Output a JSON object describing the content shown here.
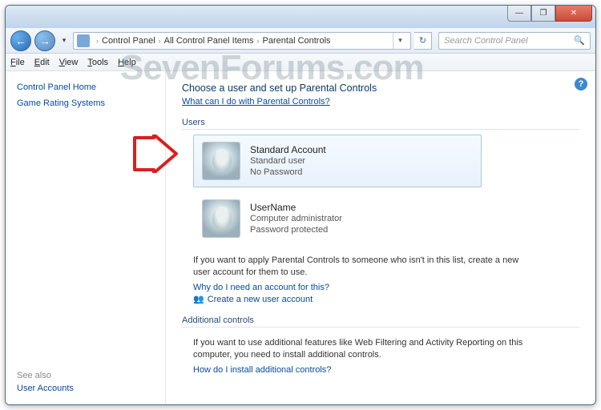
{
  "watermark": "SevenForums.com",
  "titlebar": {
    "min": "—",
    "max": "❐",
    "close": "✕"
  },
  "nav": {
    "back": "←",
    "fwd": "→",
    "dropdown": "▾",
    "address_icon": "control-panel-icon",
    "crumbs": [
      "Control Panel",
      "All Control Panel Items",
      "Parental Controls"
    ],
    "sep": "›",
    "refresh": "↻",
    "search_placeholder": "Search Control Panel",
    "search_icon": "🔍"
  },
  "menu": {
    "file": "File",
    "edit": "Edit",
    "view": "View",
    "tools": "Tools",
    "help": "Help"
  },
  "sidebar": {
    "home": "Control Panel Home",
    "rating": "Game Rating Systems",
    "see_also": "See also",
    "user_accounts": "User Accounts"
  },
  "content": {
    "heading": "Choose a user and set up Parental Controls",
    "what_link": "What can I do with Parental Controls?",
    "users_label": "Users",
    "users": [
      {
        "name": "Standard Account",
        "role": "Standard user",
        "pw": "No Password",
        "selected": true
      },
      {
        "name": "UserName",
        "role": "Computer administrator",
        "pw": "Password protected",
        "selected": false
      }
    ],
    "note1": "If you want to apply Parental Controls to someone who isn't in this list, create a new user account for them to use.",
    "why_link": "Why do I need an account for this?",
    "create_link": "Create a new user account",
    "additional_label": "Additional controls",
    "note2": "If you want to use additional features like Web Filtering and Activity Reporting on this computer, you need to install additional controls.",
    "how_link": "How do I install additional controls?",
    "help": "?"
  }
}
